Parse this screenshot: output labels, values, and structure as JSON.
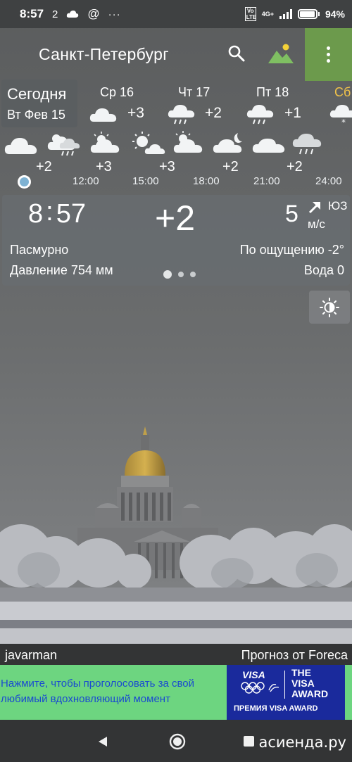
{
  "status_bar": {
    "time": "8:57",
    "notif_count": "2",
    "battery": "94%",
    "battery_level": 0.94,
    "network": "4G+",
    "volte": "Vo LTE"
  },
  "app_bar": {
    "city": "Санкт-Петербург",
    "menu_color": "#6c9a4c"
  },
  "days": [
    {
      "name": "Сегодня",
      "date": "Вт Фев 15",
      "icon": "cloudy-icon",
      "temp": ""
    },
    {
      "name": "Ср 16",
      "icon": "cloudy-icon",
      "temp": "+3"
    },
    {
      "name": "Чт 17",
      "icon": "rain-icon",
      "temp": "+2"
    },
    {
      "name": "Пт 18",
      "icon": "rain-icon",
      "temp": "+1"
    },
    {
      "name": "Сб",
      "icon": "snow-icon",
      "temp": ""
    }
  ],
  "hours": {
    "icons": [
      "cloudy-icon",
      "partly-rain-icon",
      "partly-cloudy-icon",
      "sunny-icon",
      "partly-cloudy-icon",
      "night-cloudy-icon",
      "cloudy-icon",
      "rain-icon"
    ],
    "temps": [
      "+2",
      "+3",
      "+3",
      "+2",
      "+2"
    ],
    "times": [
      "12:00",
      "15:00",
      "18:00",
      "21:00",
      "24:00"
    ]
  },
  "current": {
    "clock_h": "8",
    "clock_m": "57",
    "temp": "+2",
    "wind_speed": "5",
    "wind_dir": "ЮЗ",
    "wind_unit": "м/с",
    "condition": "Пасмурно",
    "feels_like": "По ощущению -2°",
    "pressure": "Давление 754 мм",
    "water": "Вода 0"
  },
  "credits": {
    "author": "javarman",
    "source": "Прогноз от Foreca"
  },
  "ad": {
    "text": "Нажмите, чтобы проголосовать за свой любимый вдохновляющий момент",
    "visa_logo": "VISA",
    "award_line1": "THE",
    "award_line2": "VISA",
    "award_line3": "AWARD",
    "premia": "ПРЕМИЯ VISA AWARD",
    "bg_color": "#6dd580",
    "text_color": "#1a4bd0"
  },
  "watermark": "асиенда.ру"
}
